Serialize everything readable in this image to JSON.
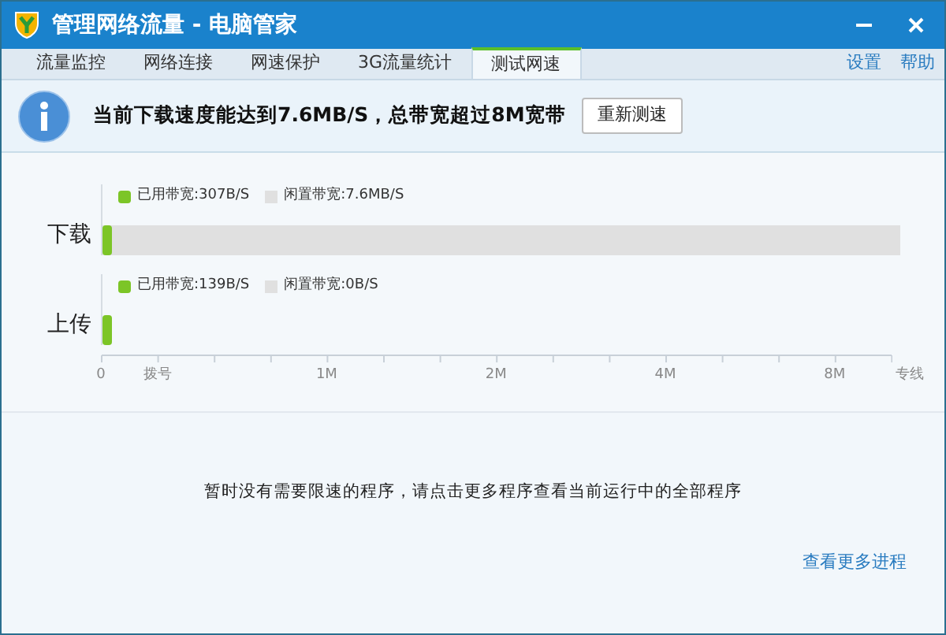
{
  "window": {
    "title": "管理网络流量 - 电脑管家"
  },
  "tabs": [
    {
      "label": "流量监控",
      "selected": false
    },
    {
      "label": "网络连接",
      "selected": false
    },
    {
      "label": "网速保护",
      "selected": false
    },
    {
      "label": "3G流量统计",
      "selected": false
    },
    {
      "label": "测试网速",
      "selected": true
    }
  ],
  "links": [
    "设置",
    "帮助"
  ],
  "banner": {
    "message": "当前下载速度能达到7.6MB/S，总带宽超过8M宽带",
    "button": "重新测速"
  },
  "rows": [
    {
      "label": "下载",
      "used": "已用带宽:307B/S",
      "idle": "闲置带宽:7.6MB/S",
      "level": 0.012,
      "track": true
    },
    {
      "label": "上传",
      "used": "已用带宽:139B/S",
      "idle": "闲置带宽:0B/S",
      "level": 0.012,
      "track": false
    }
  ],
  "axis_labels": [
    "0",
    "拨号",
    "1M",
    "2M",
    "4M",
    "8M",
    "专线"
  ],
  "notice": "暂时没有需要限速的程序，请点击更多程序查看当前运行中的全部程序",
  "more_link": "查看更多进程"
}
